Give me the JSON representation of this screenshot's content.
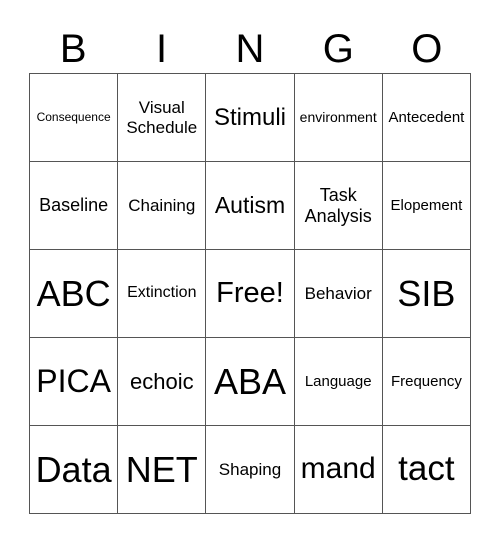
{
  "header": {
    "letters": [
      "B",
      "I",
      "N",
      "G",
      "O"
    ]
  },
  "card": {
    "rows": [
      [
        "Consequence",
        "Visual Schedule",
        "Stimuli",
        "environment",
        "Antecedent"
      ],
      [
        "Baseline",
        "Chaining",
        "Autism",
        "Task Analysis",
        "Elopement"
      ],
      [
        "ABC",
        "Extinction",
        "Free!",
        "Behavior",
        "SIB"
      ],
      [
        "PICA",
        "echoic",
        "ABA",
        "Language",
        "Frequency"
      ],
      [
        "Data",
        "NET",
        "Shaping",
        "mand",
        "tact"
      ]
    ]
  }
}
